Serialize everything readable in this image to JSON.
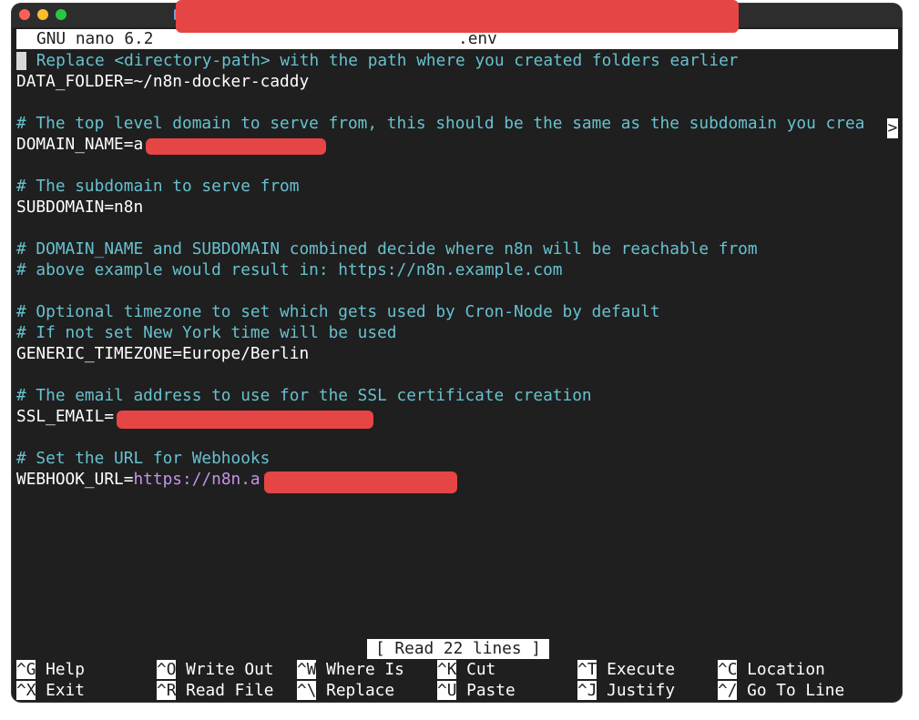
{
  "editor": {
    "version": "GNU nano 6.2",
    "filename": ".env",
    "overflow_marker": ">"
  },
  "lines": {
    "c1": "Replace <directory-path> with the path where you created folders earlier",
    "c1_hash": "#",
    "data_folder": "DATA_FOLDER=~/n8n-docker-caddy",
    "c2": "# The top level domain to serve from, this should be the same as the subdomain you crea",
    "domain_name": "DOMAIN_NAME=a",
    "c3": "# The subdomain to serve from",
    "subdomain": "SUBDOMAIN=n8n",
    "c4": "# DOMAIN_NAME and SUBDOMAIN combined decide where n8n will be reachable from",
    "c5": "# above example would result in: https://n8n.example.com",
    "c6": "# Optional timezone to set which gets used by Cron-Node by default",
    "c7": "# If not set New York time will be used",
    "timezone": "GENERIC_TIMEZONE=Europe/Berlin",
    "c8": "# The email address to use for the SSL certificate creation",
    "ssl_email": "SSL_EMAIL=",
    "c9": "# Set the URL for Webhooks",
    "webhook_key": "WEBHOOK_URL=",
    "webhook_val": "https://n8n.a"
  },
  "status_message": "[ Read 22 lines ]",
  "shortcuts": [
    {
      "key": "^G",
      "label": "Help"
    },
    {
      "key": "^X",
      "label": "Exit"
    },
    {
      "key": "^O",
      "label": "Write Out"
    },
    {
      "key": "^R",
      "label": "Read File"
    },
    {
      "key": "^W",
      "label": "Where Is"
    },
    {
      "key": "^\\",
      "label": "Replace"
    },
    {
      "key": "^K",
      "label": "Cut"
    },
    {
      "key": "^U",
      "label": "Paste"
    },
    {
      "key": "^T",
      "label": "Execute"
    },
    {
      "key": "^J",
      "label": "Justify"
    },
    {
      "key": "^C",
      "label": "Location"
    },
    {
      "key": "^/",
      "label": "Go To Line"
    }
  ],
  "colors": {
    "comment": "#67c1cf",
    "url": "#c792ea",
    "redaction": "#e64545",
    "background": "#1f1f1f"
  }
}
